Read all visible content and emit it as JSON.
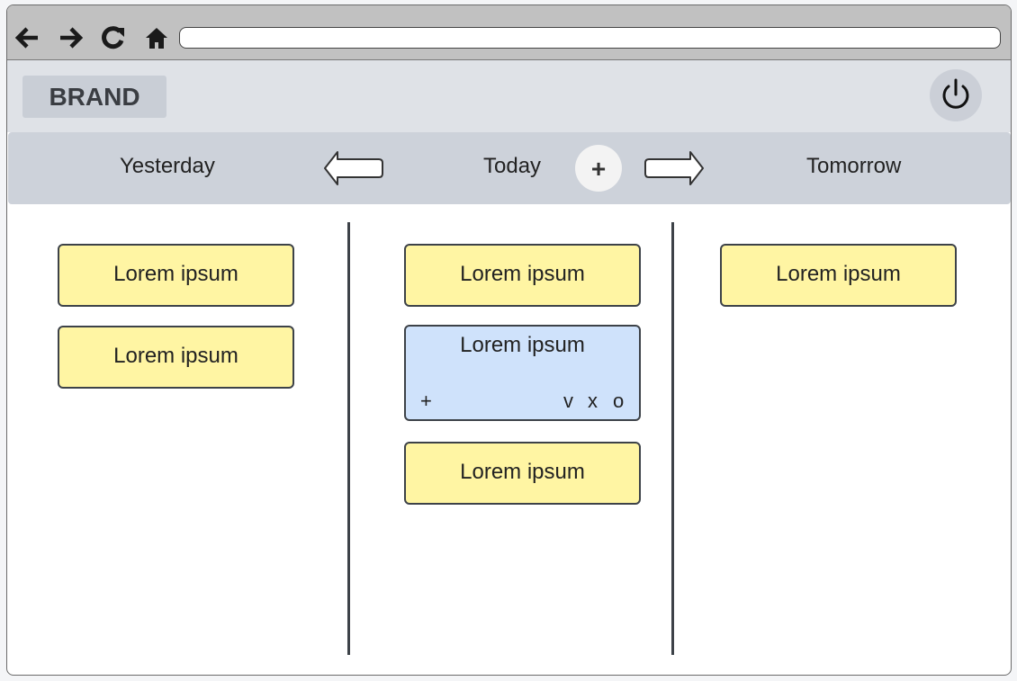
{
  "browser": {
    "nav_icons": [
      "back-arrow-icon",
      "forward-arrow-icon",
      "reload-icon",
      "home-icon"
    ],
    "address": ""
  },
  "header": {
    "brand": "BRAND",
    "power_icon": "power-icon"
  },
  "day_nav": {
    "previous": "Yesterday",
    "current": "Today",
    "next": "Tomorrow",
    "add_label": "+",
    "prev_arrow_icon": "left-arrow-icon",
    "next_arrow_icon": "right-arrow-icon"
  },
  "columns": {
    "yesterday": {
      "cards": [
        {
          "label": "Lorem ipsum"
        },
        {
          "label": "Lorem ipsum"
        }
      ]
    },
    "today": {
      "cards": [
        {
          "label": "Lorem ipsum"
        },
        {
          "label": "Lorem ipsum",
          "selected": true,
          "actions": {
            "add": "+",
            "done": "v",
            "delete": "x",
            "open": "o"
          }
        },
        {
          "label": "Lorem ipsum"
        }
      ]
    },
    "tomorrow": {
      "cards": [
        {
          "label": "Lorem ipsum"
        }
      ]
    }
  },
  "colors": {
    "card": "#fff5a3",
    "selected_card": "#cfe2fb",
    "browser_bar": "#c1c1c1",
    "header": "#dfe2e7",
    "day_nav": "#cdd2da",
    "border": "#3d4248"
  }
}
